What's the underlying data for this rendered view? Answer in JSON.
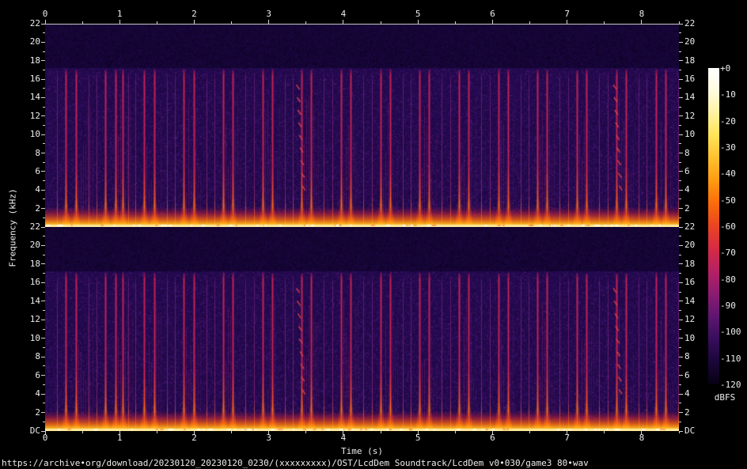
{
  "axes": {
    "time_title": "Time (s)",
    "freq_title": "Frequency (kHz)",
    "time_ticks": [
      "0",
      "1",
      "2",
      "3",
      "4",
      "5",
      "6",
      "7",
      "8"
    ],
    "time_minor_step_s": 0.5,
    "time_max_s": 8.5,
    "freq_ticks": [
      "22",
      "20",
      "18",
      "16",
      "14",
      "12",
      "10",
      "8",
      "6",
      "4",
      "2"
    ],
    "dc_label": "DC",
    "freq_max_khz": 22
  },
  "colorbar": {
    "labels": [
      "+0",
      "-10",
      "-20",
      "-30",
      "-40",
      "-50",
      "-60",
      "-70",
      "-80",
      "-90",
      "-100",
      "-110",
      "-120"
    ],
    "unit": "dBFS",
    "gradient_colors": [
      "#ffffff",
      "#fffbe0",
      "#fff3a0",
      "#ffe356",
      "#ffc02e",
      "#ff9a10",
      "#fa6b0a",
      "#ea4423",
      "#d62a45",
      "#b52164",
      "#8c1b72",
      "#5e1670",
      "#370e5c",
      "#1a0638",
      "#070113"
    ]
  },
  "footer": {
    "source_path": "https://archive•org/download/20230120_20230120_0230/(xxxxxxxxx)/OST/LcdDem Soundtrack/LcdDem v0•030/game3 80•wav"
  },
  "chart_data": {
    "type": "heatmap",
    "subtype": "spectrogram",
    "channels": 2,
    "duration_s": 8.5,
    "freq_range_khz": [
      0,
      22
    ],
    "lowpass_cutoff_khz": 17.2,
    "db_range_dbfs": [
      -120,
      0
    ],
    "strong_hit_times_s": [
      0.28,
      0.41,
      0.81,
      0.94,
      1.04,
      1.33,
      1.46,
      1.86,
      1.99,
      2.39,
      2.52,
      2.92,
      3.05,
      3.44,
      3.57,
      3.97,
      4.1,
      4.5,
      4.63,
      5.02,
      5.15,
      5.55,
      5.68,
      6.08,
      6.21,
      6.6,
      6.73,
      7.13,
      7.26,
      7.66,
      7.79,
      8.19,
      8.32
    ],
    "faint_hit_times_s": [
      0.16,
      0.58,
      0.69,
      1.11,
      1.21,
      1.63,
      1.74,
      2.16,
      2.27,
      2.69,
      2.8,
      3.22,
      3.32,
      3.74,
      3.85,
      4.27,
      4.38,
      4.8,
      4.9,
      5.32,
      5.43,
      5.85,
      5.96,
      6.38,
      6.48,
      6.9,
      7.01,
      7.43,
      7.54,
      7.96,
      8.07,
      8.49
    ],
    "arpeggio_times_s": [
      3.37,
      7.62
    ],
    "palette": {
      "bg_above_cutoff": "#150535",
      "bg_below_cutoff": "#23094d",
      "noise_bright": "#5a1b8c",
      "noise_dark": "#1b0540",
      "spike_crimson": "#c22055",
      "spike_hot": "#ef4f2a",
      "band_orange": "#ff9212",
      "band_yellow": "#ffd84a",
      "band_white": "#ffe897"
    }
  }
}
